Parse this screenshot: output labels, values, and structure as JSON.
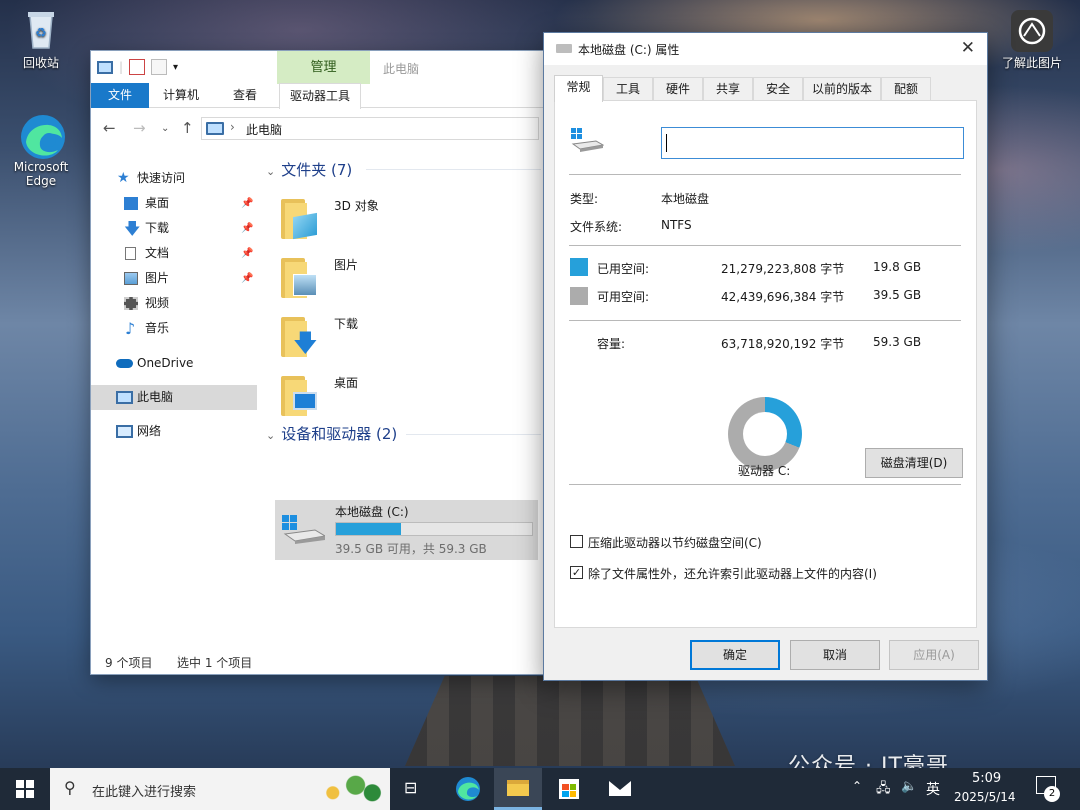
{
  "desktop": {
    "recycle_bin": "回收站",
    "edge_line1": "Microsoft",
    "edge_line2": "Edge",
    "learn_image": "了解此图片"
  },
  "explorer": {
    "contextual_group": "管理",
    "context_title": "此电脑",
    "tabs": {
      "file": "文件",
      "computer": "计算机",
      "view": "查看",
      "drive_tools": "驱动器工具"
    },
    "address": "此电脑",
    "nav": {
      "quick_access": "快速访问",
      "desktop": "桌面",
      "downloads": "下载",
      "documents": "文档",
      "pictures": "图片",
      "videos": "视频",
      "music": "音乐",
      "onedrive": "OneDrive",
      "this_pc": "此电脑",
      "network": "网络"
    },
    "folders_header": "文件夹 (7)",
    "folders": [
      "3D 对象",
      "图片",
      "下载",
      "桌面"
    ],
    "devices_header": "设备和驱动器 (2)",
    "drive": {
      "name": "本地磁盘 (C:)",
      "free_text": "39.5 GB 可用，共 59.3 GB",
      "used_fraction": 0.334
    },
    "status_items": "9 个项目",
    "status_selected": "选中 1 个项目"
  },
  "properties": {
    "title": "本地磁盘 (C:) 属性",
    "tabs": [
      "常规",
      "工具",
      "硬件",
      "共享",
      "安全",
      "以前的版本",
      "配额"
    ],
    "volume_label_value": "",
    "type_label": "类型:",
    "type_value": "本地磁盘",
    "fs_label": "文件系统:",
    "fs_value": "NTFS",
    "used_label": "已用空间:",
    "used_bytes": "21,279,223,808 字节",
    "used_gb": "19.8 GB",
    "free_label": "可用空间:",
    "free_bytes": "42,439,696,384 字节",
    "free_gb": "39.5 GB",
    "capacity_label": "容量:",
    "capacity_bytes": "63,718,920,192 字节",
    "capacity_gb": "59.3 GB",
    "drive_label": "驱动器 C:",
    "cleanup_button": "磁盘清理(D)",
    "compress_label": "压缩此驱动器以节约磁盘空间(C)",
    "compress_checked": false,
    "index_label": "除了文件属性外，还允许索引此驱动器上文件的内容(I)",
    "index_checked": true,
    "ok": "确定",
    "cancel": "取消",
    "apply": "应用(A)",
    "colors": {
      "used": "#26a0da",
      "free": "#acacac"
    }
  },
  "taskbar": {
    "search_placeholder": "在此键入进行搜索",
    "ime": "英",
    "time": "5:09",
    "date": "2025/5/14",
    "notification_count": "2"
  },
  "watermark": "公众号 · IT豪哥"
}
